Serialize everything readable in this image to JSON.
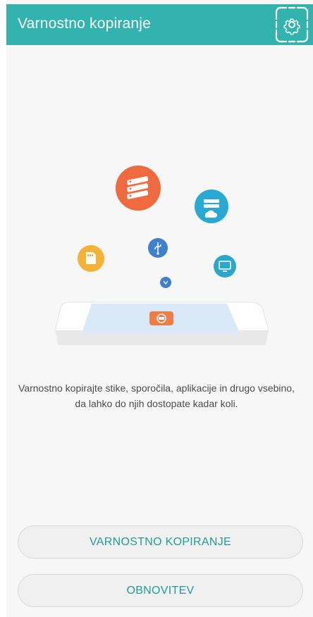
{
  "app_bar": {
    "title": "Varnostno kopiranje",
    "settings_icon": "gear-icon",
    "color": "#32b3ad"
  },
  "illustration": {
    "icons": [
      "database-icon",
      "cloud-server-icon",
      "sd-card-icon",
      "usb-icon",
      "monitor-icon",
      "wireless-icon",
      "phone-backup-icon"
    ]
  },
  "description": "Varnostno kopirajte stike, sporočila, aplikacije in drugo vsebino, da lahko do njih dostopate kadar koli.",
  "buttons": {
    "backup": "VARNOSTNO KOPIRANJE",
    "restore": "OBNOVITEV"
  }
}
